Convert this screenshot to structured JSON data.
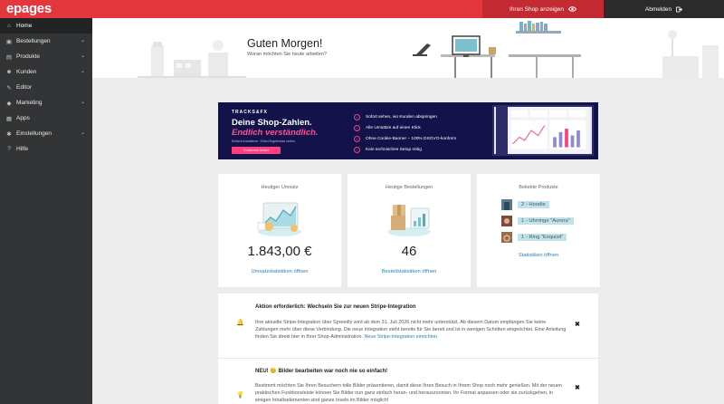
{
  "topbar": {
    "logo": "epages",
    "show_shop": "Ihren Shop anzeigen",
    "logout": "Abmelden"
  },
  "sidebar": {
    "items": [
      {
        "label": "Home",
        "icon": "home-icon",
        "glyph": "⌂"
      },
      {
        "label": "Bestellungen",
        "icon": "cart-icon",
        "glyph": "▣"
      },
      {
        "label": "Produkte",
        "icon": "box-icon",
        "glyph": "▤"
      },
      {
        "label": "Kunden",
        "icon": "users-icon",
        "glyph": "☻"
      },
      {
        "label": "Editor",
        "icon": "pencil-icon",
        "glyph": "✎"
      },
      {
        "label": "Marketing",
        "icon": "tag-icon",
        "glyph": "◆"
      },
      {
        "label": "Apps",
        "icon": "apps-icon",
        "glyph": "▦"
      },
      {
        "label": "Einstellungen",
        "icon": "gear-icon",
        "glyph": "✱"
      },
      {
        "label": "Hilfe",
        "icon": "help-icon",
        "glyph": "?"
      }
    ]
  },
  "header": {
    "title": "Guten Morgen!",
    "subtitle": "Woran möchten Sie heute arbeiten?"
  },
  "banner": {
    "logo": "TRACKS&FX",
    "headline1": "Deine Shop-Zahlen.",
    "headline2": "Endlich verständlich.",
    "small": "Einfach installieren. Sofort Ergebnisse sehen.",
    "button": "Kostenlos testen",
    "bullets": [
      "Sofort sehen, wo Kunden abspringen",
      "Alle Umsätze auf einen Klick",
      "Ohne Cookie-Banner – 100% DSGVO-konform",
      "Kein technisches Setup nötig"
    ]
  },
  "cards": {
    "revenue": {
      "title": "Heutiger Umsatz",
      "value": "1.843,00 €",
      "link": "Umsatzstatistiken öffnen"
    },
    "orders": {
      "title": "Heutige Bestellungen",
      "value": "46",
      "link": "Bestellstatistiken öffnen"
    },
    "products": {
      "title": "Beliebte Produkte",
      "items": [
        "2 - Hoodie",
        "1 - Uhrringe \"Aurora\"",
        "1 - Ring \"Exquisit\""
      ],
      "link": "Statistiken öffnen"
    }
  },
  "notices": [
    {
      "title": "Aktion erforderlich: Wechseln Sie zur neuen Stripe-Integration",
      "body": "Ihre aktuelle Stripe-Integration über Spreedly wird ab dem 31. Juli 2026 nicht mehr unterstützt. Ab diesem Datum empfangen Sie keine Zahlungen mehr über diese Verbindung. Die neue Integration steht bereits für Sie bereit und ist in wenigen Schritten eingerichtet. Eine Anleitung finden Sie direkt hier in Ihrer Shop-Administration.",
      "link": "Neue Stripe-Integration einrichten"
    },
    {
      "title": "NEU! 😊 Bilder bearbeiten war noch nie so einfach!",
      "body": "Bestimmt möchten Sie Ihren Besuchern tolle Bilder präsentieren, damit diese Ihren Besuch in Ihrem Shop noch mehr genießen. Mit der neuen praktischen Funktionsleiste können Sie Bilder nun ganz einfach heran- und herauszoomen. Ihr Format anpassen oder sie zurückgehen, in einigen Inhaltselementen sind ganze Inseln im Bilder möglich!"
    }
  ],
  "colors": {
    "brand": "#e4363d",
    "sidebar": "#333436",
    "link": "#2b7fbd",
    "banner_bg": "#13124a",
    "banner_accent": "#ff3d7f"
  }
}
